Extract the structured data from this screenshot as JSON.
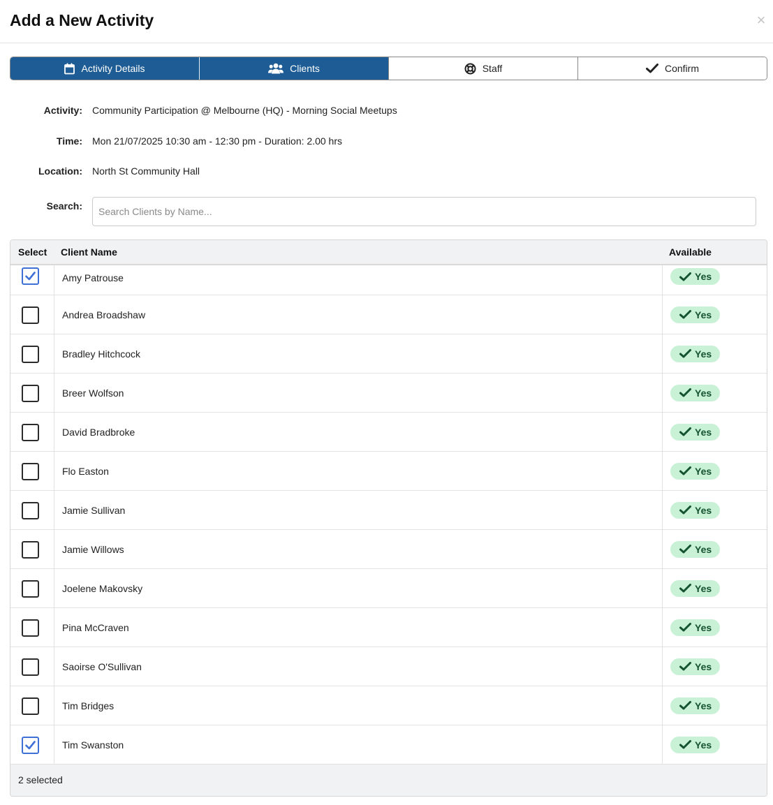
{
  "dialog": {
    "title": "Add a New Activity",
    "close_label": "×"
  },
  "steps": [
    {
      "label": "Activity Details",
      "icon": "calendar-icon",
      "active": true
    },
    {
      "label": "Clients",
      "icon": "users-icon",
      "active": true
    },
    {
      "label": "Staff",
      "icon": "lifebuoy-icon",
      "active": false
    },
    {
      "label": "Confirm",
      "icon": "check-icon",
      "active": false
    }
  ],
  "details": {
    "activity_label": "Activity:",
    "activity_value": "Community Participation @ Melbourne (HQ) - Morning Social Meetups",
    "time_label": "Time:",
    "time_value": "Mon 21/07/2025 10:30 am - 12:30 pm - Duration: 2.00 hrs",
    "location_label": "Location:",
    "location_value": "North St Community Hall",
    "search_label": "Search:",
    "search_value": "",
    "search_placeholder": "Search Clients by Name..."
  },
  "table": {
    "headers": {
      "select": "Select",
      "name": "Client Name",
      "available": "Available"
    },
    "rows": [
      {
        "name": "Amy Patrouse",
        "selected": true,
        "available": "Yes"
      },
      {
        "name": "Andrea Broadshaw",
        "selected": false,
        "available": "Yes"
      },
      {
        "name": "Bradley Hitchcock",
        "selected": false,
        "available": "Yes"
      },
      {
        "name": "Breer Wolfson",
        "selected": false,
        "available": "Yes"
      },
      {
        "name": "David Bradbroke",
        "selected": false,
        "available": "Yes"
      },
      {
        "name": "Flo Easton",
        "selected": false,
        "available": "Yes"
      },
      {
        "name": "Jamie Sullivan",
        "selected": false,
        "available": "Yes"
      },
      {
        "name": "Jamie Willows",
        "selected": false,
        "available": "Yes"
      },
      {
        "name": "Joelene Makovsky",
        "selected": false,
        "available": "Yes"
      },
      {
        "name": "Pina McCraven",
        "selected": false,
        "available": "Yes"
      },
      {
        "name": "Saoirse O'Sullivan",
        "selected": false,
        "available": "Yes"
      },
      {
        "name": "Tim Bridges",
        "selected": false,
        "available": "Yes"
      },
      {
        "name": "Tim Swanston",
        "selected": true,
        "available": "Yes"
      }
    ],
    "footer": "2 selected"
  },
  "colors": {
    "active_step": "#1d5c94",
    "checkbox_checked": "#3e70d6",
    "badge_bg": "#c8f1d6",
    "badge_text": "#14532d"
  }
}
